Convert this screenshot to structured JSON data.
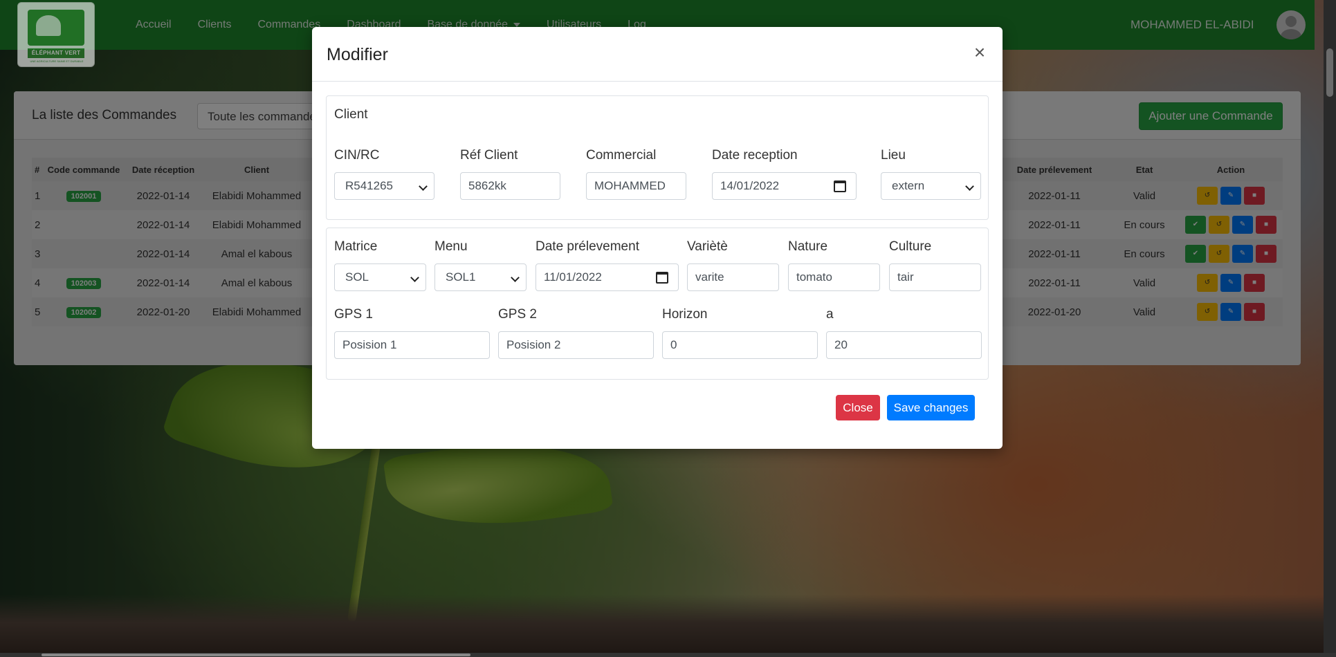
{
  "nav": {
    "logo_brand": "ÉLÉPHANT VERT",
    "logo_tagline": "UNE AGRICULTURE SAINE ET DURABLE",
    "links": [
      "Accueil",
      "Clients",
      "Commandes",
      "Dashboard",
      "Base de donnée",
      "Utilisateurs",
      "Log"
    ],
    "user": "MOHAMMED EL-ABIDI"
  },
  "list": {
    "title": "La liste des Commandes",
    "filter_value": "Toute les commandes",
    "add_button": "Ajouter une Commande",
    "headers": [
      "#",
      "Code commande",
      "Date réception",
      "Client",
      "Date prélevement",
      "Etat",
      "Action"
    ],
    "rows": [
      {
        "idx": "1",
        "code": "102001",
        "date": "2022-01-14",
        "client": "Elabidi Mohammed",
        "date_prel": "2022-01-11",
        "etat": "Valid",
        "actions": [
          "undo",
          "edit",
          "delete"
        ]
      },
      {
        "idx": "2",
        "code": "",
        "date": "2022-01-14",
        "client": "Elabidi Mohammed",
        "date_prel": "2022-01-11",
        "etat": "En cours",
        "actions": [
          "validate",
          "undo",
          "edit",
          "delete"
        ]
      },
      {
        "idx": "3",
        "code": "",
        "date": "2022-01-14",
        "client": "Amal el kabous",
        "date_prel": "2022-01-11",
        "etat": "En cours",
        "actions": [
          "validate",
          "undo",
          "edit",
          "delete"
        ]
      },
      {
        "idx": "4",
        "code": "102003",
        "date": "2022-01-14",
        "client": "Amal el kabous",
        "date_prel": "2022-01-11",
        "etat": "Valid",
        "actions": [
          "undo",
          "edit",
          "delete"
        ]
      },
      {
        "idx": "5",
        "code": "102002",
        "date": "2022-01-20",
        "client": "Elabidi Mohammed",
        "date_prel": "2022-01-20",
        "etat": "Valid",
        "actions": [
          "undo",
          "edit",
          "delete"
        ]
      }
    ]
  },
  "modal": {
    "title": "Modifier",
    "close_glyph": "×",
    "client_section": "Client",
    "cin_label": "CIN/RC",
    "cin_value": "R541265",
    "ref_label": "Réf Client",
    "ref_value": "5862kk",
    "commercial_label": "Commercial",
    "commercial_value": "MOHAMMED",
    "date_reception_label": "Date reception",
    "date_reception_value": "14/01/2022",
    "lieu_label": "Lieu",
    "lieu_value": "extern",
    "matrice_label": "Matrice",
    "matrice_value": "SOL",
    "menu_label": "Menu",
    "menu_value": "SOL1",
    "date_prelevement_label": "Date prélevement",
    "date_prelevement_value": "11/01/2022",
    "variete_label": "Variètè",
    "variete_value": "varite",
    "nature_label": "Nature",
    "nature_value": "tomato",
    "culture_label": "Culture",
    "culture_value": "tair",
    "gps1_label": "GPS 1",
    "gps1_value": "Posision 1",
    "gps2_label": "GPS 2",
    "gps2_value": "Posision 2",
    "horizon_label": "Horizon",
    "horizon_value": "0",
    "a_label": "a",
    "a_value": "20",
    "close_button": "Close",
    "save_button": "Save changes"
  },
  "colors": {
    "navbar": "#1f8a2c",
    "success": "#28a745",
    "primary": "#007bff",
    "danger": "#dc3545",
    "warning": "#ffc107"
  }
}
